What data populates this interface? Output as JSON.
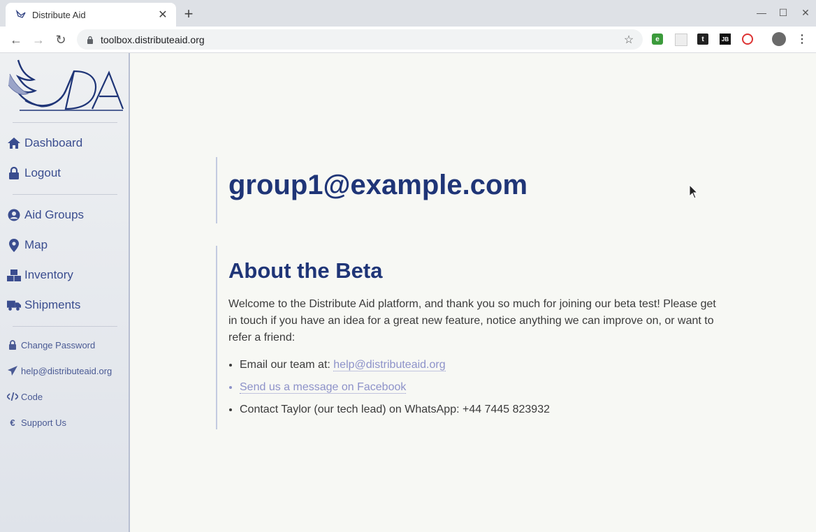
{
  "browser": {
    "tab_title": "Distribute Aid",
    "url": "toolbox.distributeaid.org",
    "extensions": [
      "evernote-icon",
      "blank-extension-icon",
      "twitter-icon",
      "jetbrains-icon",
      "lastpass-icon"
    ]
  },
  "sidebar": {
    "primary": [
      {
        "label": "Dashboard",
        "icon": "home-icon"
      },
      {
        "label": "Logout",
        "icon": "lock-icon"
      }
    ],
    "sections": [
      {
        "label": "Aid Groups",
        "icon": "user-circle-icon"
      },
      {
        "label": "Map",
        "icon": "map-marker-icon"
      },
      {
        "label": "Inventory",
        "icon": "boxes-icon"
      },
      {
        "label": "Shipments",
        "icon": "truck-icon"
      }
    ],
    "footer": [
      {
        "label": "Change Password",
        "icon": "lock-icon"
      },
      {
        "label": "help@distributeaid.org",
        "icon": "paper-plane-icon"
      },
      {
        "label": "Code",
        "icon": "code-icon"
      },
      {
        "label": "Support Us",
        "icon": "euro-icon"
      }
    ]
  },
  "main": {
    "user_email": "group1@example.com",
    "about_title": "About the Beta",
    "about_text": "Welcome to the Distribute Aid platform, and thank you so much for joining our beta test! Please get in touch if you have an idea for a great new feature, notice anything we can improve on, or want to refer a friend:",
    "contact": {
      "email_prefix": "Email our team at: ",
      "email_link": "help@distributeaid.org",
      "facebook_link": "Send us a message on Facebook",
      "whatsapp_text": "Contact Taylor (our tech lead) on WhatsApp: +44 7445 823932"
    }
  },
  "colors": {
    "brand_blue": "#1f3577",
    "nav_text": "#3a4d8f",
    "link": "#8d92c9",
    "background": "#f7f8f4"
  }
}
